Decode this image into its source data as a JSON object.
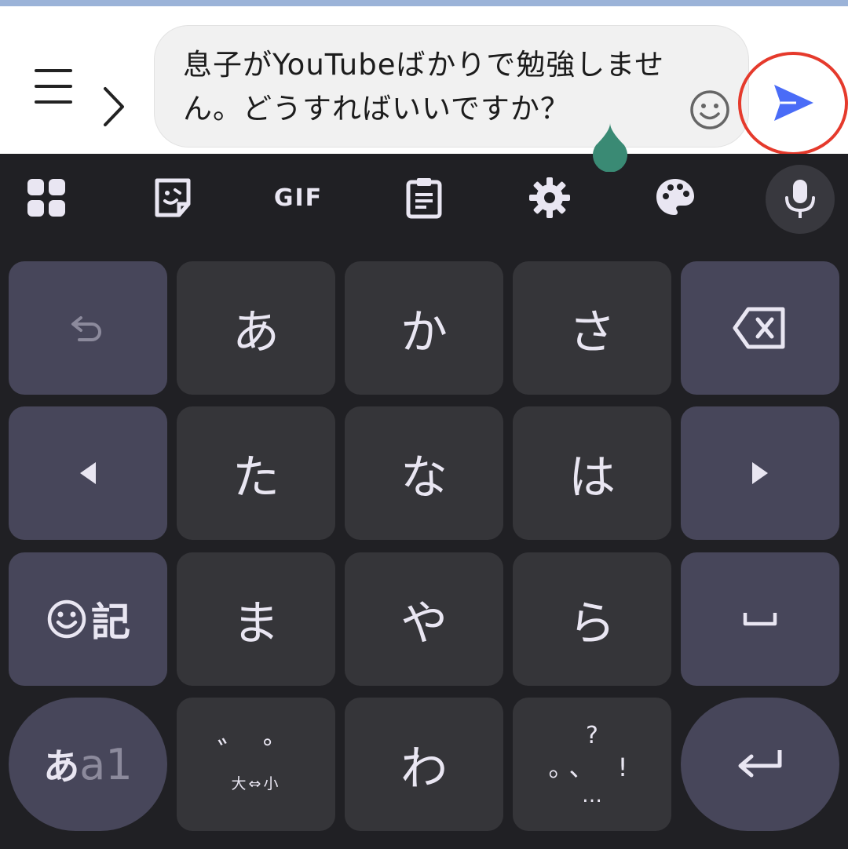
{
  "compose": {
    "text": "息子がYouTubeばかりで勉強しません。どうすればいいですか？"
  },
  "icons": {
    "menu": "hamburger-menu-icon",
    "expand": "chevron-right-icon",
    "emoji": "smiley-icon",
    "send": "send-arrow-icon",
    "apps": "apps-grid-icon",
    "sticker": "sticker-icon",
    "gif": "gif-icon",
    "clipboard": "clipboard-icon",
    "settings": "gear-icon",
    "theme": "palette-icon",
    "voice": "microphone-icon"
  },
  "toolbar": {
    "gif_label": "GIF"
  },
  "keys": {
    "a": "あ",
    "ka": "か",
    "sa": "さ",
    "ta": "た",
    "na": "な",
    "ha": "は",
    "ma": "ま",
    "ya": "や",
    "ra": "ら",
    "wa": "わ",
    "emoji_kigou": "記",
    "mode_kana": "あ",
    "mode_alpha": "a1",
    "dakuten_sub": "大⇔小",
    "dakuten_marks": "゛゜",
    "punct_top": "?",
    "punct_mid": "。、 !",
    "punct_bottom": "…"
  },
  "colors": {
    "accent_send": "#4a6cf7",
    "highlight_ring": "#e53a2c",
    "cursor_handle": "#3a8a74",
    "key_char": "#353539",
    "key_func": "#47465a",
    "keyboard_bg": "#202024"
  }
}
